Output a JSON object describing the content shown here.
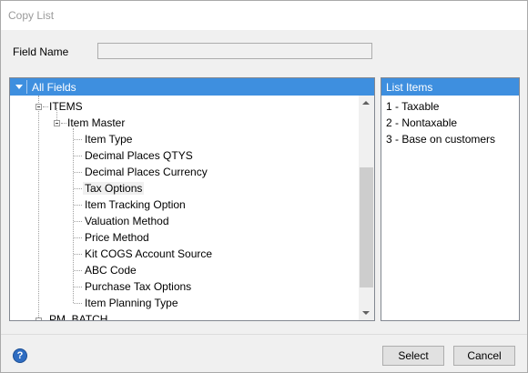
{
  "window": {
    "title": "Copy List"
  },
  "field": {
    "label": "Field Name",
    "value": ""
  },
  "tree": {
    "header": "All Fields",
    "root": "ITEMS",
    "group": "Item Master",
    "items": [
      "Item Type",
      "Decimal Places QTYS",
      "Decimal Places Currency",
      "Tax Options",
      "Item Tracking Option",
      "Valuation Method",
      "Price Method",
      "Kit COGS Account Source",
      "ABC Code",
      "Purchase Tax Options",
      "Item Planning Type"
    ],
    "selected": "Tax Options",
    "next_root": "PM_BATCH"
  },
  "list": {
    "header": "List Items",
    "items": [
      "1 - Taxable",
      "2 - Nontaxable",
      "3 - Base on customers"
    ]
  },
  "footer": {
    "select_label": "Select",
    "cancel_label": "Cancel"
  },
  "colors": {
    "header_blue": "#3e8fdf",
    "help_blue": "#2f6dc2"
  },
  "icons": {
    "help": "help-icon",
    "collapse": "collapse-icon",
    "expand": "expand-icon"
  }
}
